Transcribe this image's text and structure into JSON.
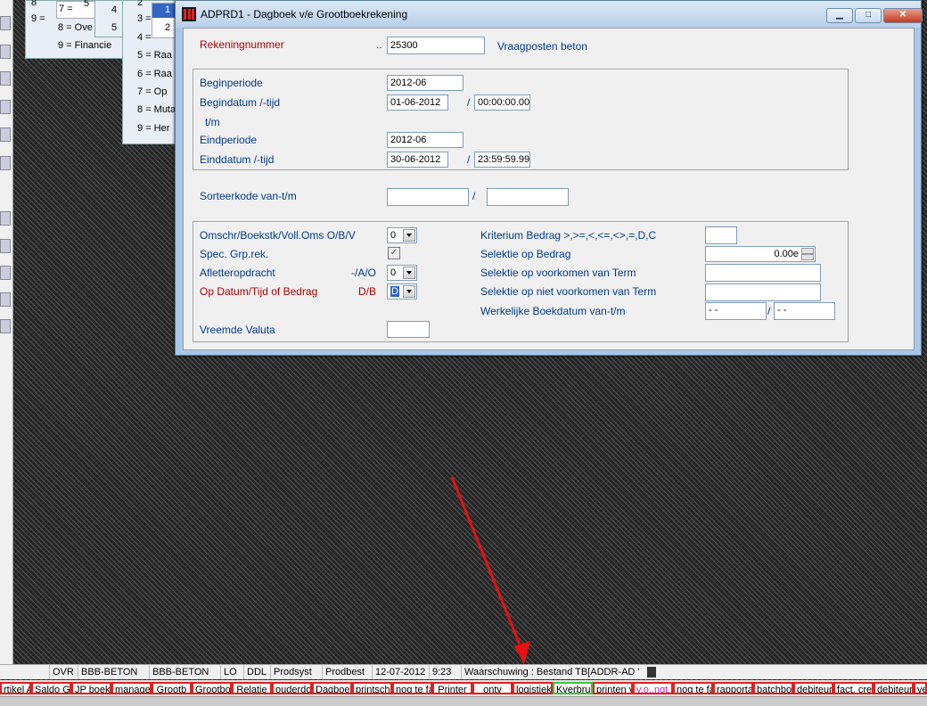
{
  "bg_windows": {
    "w1_lines": [
      "8",
      "9 =",
      "7 =",
      "5",
      "8 = Ove",
      "9 = Financie"
    ],
    "w2_lines": [
      "4",
      "3",
      "5",
      "5"
    ],
    "w3_lines": [
      "2",
      "3 =",
      "4 =",
      "5 = Raa",
      "6 = Raa",
      "7 = Op",
      "8 = Muta",
      "9 = Her"
    ],
    "w3_inner": [
      "1",
      "2"
    ]
  },
  "dialog": {
    "title": "ADPRD1 - Dagboek v/e Grootboekrekening",
    "controls": {
      "minimize": "▁",
      "maximize": "□",
      "close": "✕"
    },
    "rekeningnummer": {
      "label": "Rekeningnummer",
      "dots": "..",
      "value": "25300",
      "description": "Vraagposten beton"
    },
    "period": {
      "beginperiode_label": "Beginperiode",
      "beginperiode": "2012-06",
      "begindatum_label": "Begindatum /-tijd",
      "begindatum": "01-06-2012",
      "begintijd": "00:00:00.00",
      "tm_label": "t/m",
      "eindperiode_label": "Eindperiode",
      "eindperiode": "2012-06",
      "einddatum_label": "Einddatum /-tijd",
      "einddatum": "30-06-2012",
      "eindtijd": "23:59:59.99",
      "slash": "/"
    },
    "sorteer": {
      "label": "Sorteerkode van-t/m",
      "from": "",
      "to": "",
      "slash": "/"
    },
    "options": {
      "omschr_label": "Omschr/Boekstk/Voll.Oms O/B/V",
      "omschr_value": "0",
      "spec_label": "Spec. Grp.rek.",
      "spec_checked": "✓",
      "afletter_label": "Afletteropdracht",
      "afletter_hint": "-/A/O",
      "afletter_value": "0",
      "opdatum_label": "Op Datum/Tijd of Bedrag",
      "opdatum_hint": "D/B",
      "opdatum_value": "D",
      "valuta_label": "Vreemde Valuta",
      "valuta_value": "",
      "kriterium_label": "Kriterium Bedrag >,>=,<,<=,<>,=,D,C",
      "kriterium_value": "",
      "selbedrag_label": "Selektie op Bedrag",
      "selbedrag_value": "0.00e",
      "selterm_label": "Selektie op voorkomen van Term",
      "selterm_value": "",
      "selnietterm_label": "Selektie op niet voorkomen van Term",
      "selnietterm_value": "",
      "werkelijk_label": "Werkelijke Boekdatum van-t/m",
      "werkelijk_from": "- -",
      "werkelijk_to": "- -",
      "slash": "/"
    }
  },
  "statusbar": [
    "OVR",
    "BBB-BETON",
    "BBB-BETON",
    "LO",
    "DDL",
    "Prodsyst",
    "Prodbest",
    "12-07-2012",
    "9:23",
    "Waarschuwing : Bestand TB[ADDR-AD '"
  ],
  "taskbar": [
    {
      "label": "rtikel A"
    },
    {
      "label": "Saldo Gr"
    },
    {
      "label": "JP boeke"
    },
    {
      "label": "manager"
    },
    {
      "label": "Grootb"
    },
    {
      "label": "Grootboe"
    },
    {
      "label": "Relatie"
    },
    {
      "label": "ouderdo"
    },
    {
      "label": "Dagboek"
    },
    {
      "label": "printsche"
    },
    {
      "label": "nog te fa"
    },
    {
      "label": "Printer"
    },
    {
      "label": "ontv"
    },
    {
      "label": "logistieke"
    },
    {
      "label": "Kverbrui",
      "style": "green"
    },
    {
      "label": "printen v"
    },
    {
      "label": "v.o.,ngt.",
      "style": "pink"
    },
    {
      "label": "nog te fa"
    },
    {
      "label": "rapporta"
    },
    {
      "label": "batchboe"
    },
    {
      "label": "debiteure"
    },
    {
      "label": "fact. cre"
    },
    {
      "label": "debiteur"
    },
    {
      "label": "ve"
    }
  ],
  "colors": {
    "arrow": "#e81010",
    "label_blue": "#003a8c",
    "label_red": "#b20000"
  }
}
